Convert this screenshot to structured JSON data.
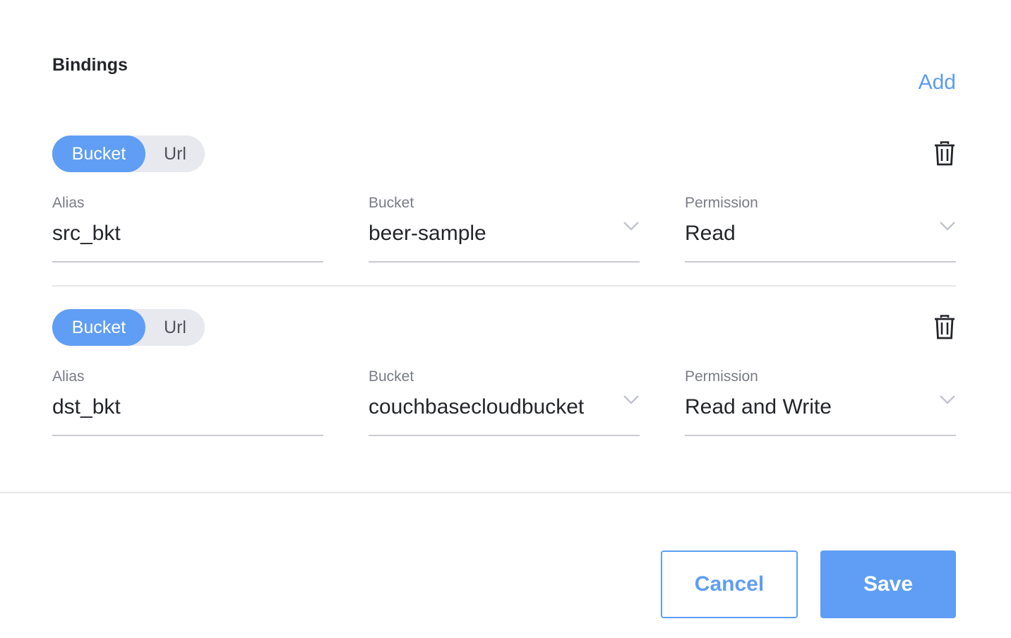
{
  "header": {
    "title": "Bindings",
    "add_label": "Add"
  },
  "bindings": [
    {
      "toggle": {
        "bucket_label": "Bucket",
        "url_label": "Url",
        "selected": "Bucket"
      },
      "alias": {
        "label": "Alias",
        "value": "src_bkt"
      },
      "bucket": {
        "label": "Bucket",
        "value": "beer-sample"
      },
      "permission": {
        "label": "Permission",
        "value": "Read"
      }
    },
    {
      "toggle": {
        "bucket_label": "Bucket",
        "url_label": "Url",
        "selected": "Bucket"
      },
      "alias": {
        "label": "Alias",
        "value": "dst_bkt"
      },
      "bucket": {
        "label": "Bucket",
        "value": "couchbasecloudbucket"
      },
      "permission": {
        "label": "Permission",
        "value": "Read and Write"
      }
    }
  ],
  "footer": {
    "cancel_label": "Cancel",
    "save_label": "Save"
  },
  "colors": {
    "accent": "#5f9ef4",
    "text": "#24262b",
    "label": "#7a7d87",
    "toggle_bg": "#e7e9ef"
  },
  "icons": {
    "delete": "trash-icon",
    "dropdown": "chevron-down-icon"
  }
}
